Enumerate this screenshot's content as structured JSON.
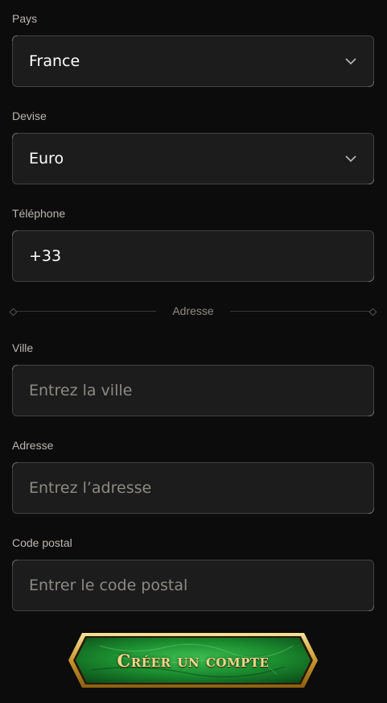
{
  "fields": {
    "country": {
      "label": "Pays",
      "value": "France"
    },
    "currency": {
      "label": "Devise",
      "value": "Euro"
    },
    "phone": {
      "label": "Téléphone",
      "value": "+33"
    },
    "city": {
      "label": "Ville",
      "placeholder": "Entrez la ville"
    },
    "address": {
      "label": "Adresse",
      "placeholder": "Entrez l’adresse"
    },
    "postal_code": {
      "label": "Code postal",
      "placeholder": "Entrer le code postal"
    }
  },
  "section_divider": {
    "label": "Adresse"
  },
  "submit_button": {
    "label": "Créer un compte"
  },
  "icons": {
    "select_chevron": "chevron-down-icon"
  },
  "colors": {
    "background": "#0d0c0c",
    "field_background": "#1c1c1c",
    "field_border": "#444240",
    "label_text": "#b9b6b2",
    "placeholder_text": "#8d8a86",
    "button_green": "#1e8a34",
    "button_gold": "#d9b45a"
  }
}
